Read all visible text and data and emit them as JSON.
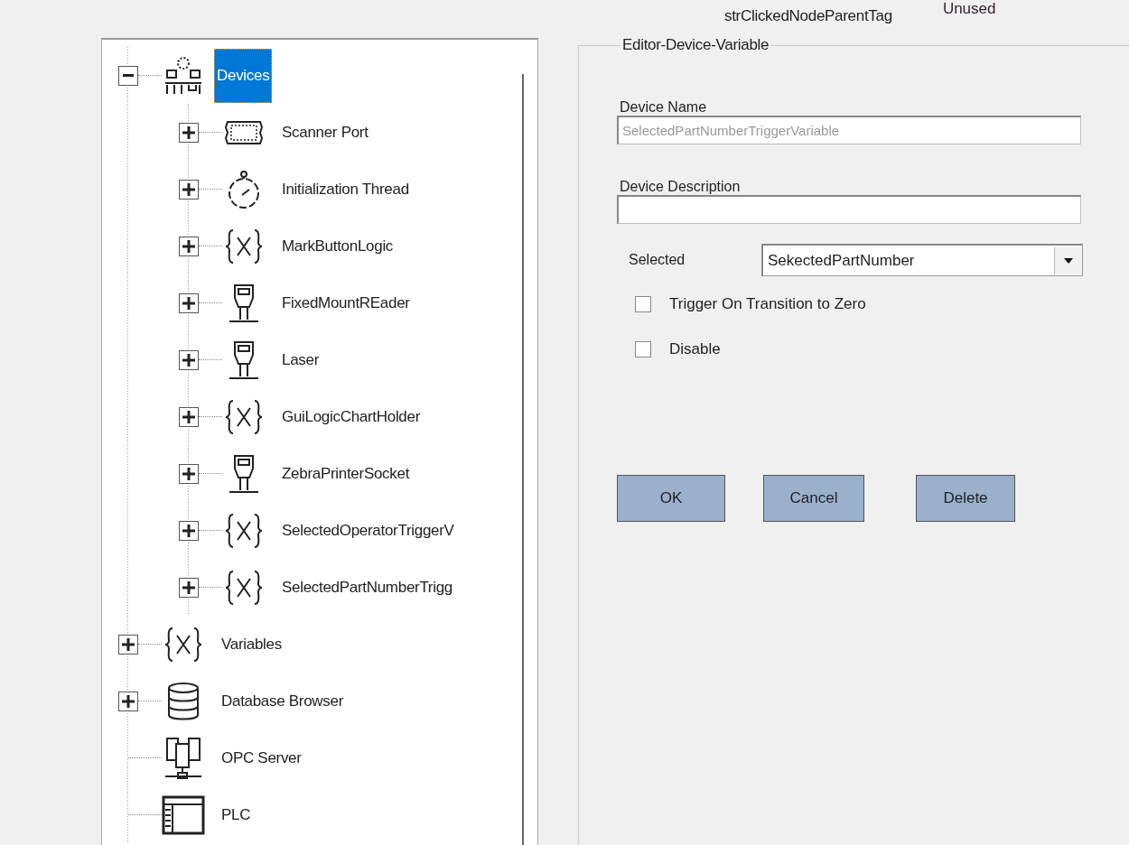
{
  "header": {
    "tag_label": "strClickedNodeParentTag",
    "tag_value": "Unused"
  },
  "tree": [
    {
      "label": "Devices",
      "kind": "network",
      "selected": true,
      "expanded": true,
      "children": [
        {
          "label": "Scanner Port",
          "kind": "port",
          "selected": false,
          "expanded": false
        },
        {
          "label": "Initialization Thread",
          "kind": "stopwatch",
          "selected": false,
          "expanded": false
        },
        {
          "label": "MarkButtonLogic",
          "kind": "variable",
          "selected": false,
          "expanded": false
        },
        {
          "label": "FixedMountREader",
          "kind": "scanner",
          "selected": false,
          "expanded": false
        },
        {
          "label": "Laser",
          "kind": "scanner",
          "selected": false,
          "expanded": false
        },
        {
          "label": "GuiLogicChartHolder",
          "kind": "variable",
          "selected": false,
          "expanded": false
        },
        {
          "label": "ZebraPrinterSocket",
          "kind": "scanner",
          "selected": false,
          "expanded": false
        },
        {
          "label": "SelectedOperatorTriggerV",
          "kind": "variable",
          "selected": false,
          "expanded": false
        },
        {
          "label": "SelectedPartNumberTrigg",
          "kind": "variable",
          "selected": false,
          "expanded": false
        }
      ]
    },
    {
      "label": "Variables",
      "kind": "variable",
      "selected": false,
      "expanded": false
    },
    {
      "label": "Database Browser",
      "kind": "database",
      "selected": false,
      "expanded": false
    },
    {
      "label": "OPC Server",
      "kind": "server",
      "selected": false
    },
    {
      "label": "PLC",
      "kind": "plc",
      "selected": false
    }
  ],
  "editor": {
    "title": "Editor-Device-Variable",
    "device_name": {
      "label": "Device Name",
      "value": "SelectedPartNumberTriggerVariable",
      "disabled": true
    },
    "device_description": {
      "label": "Device Description"
    },
    "selected": {
      "label": "Selected",
      "value": "SekectedPartNumber"
    },
    "checkboxes": [
      {
        "label": "Trigger On Transition to Zero",
        "checked": false
      },
      {
        "label": "Disable",
        "checked": false
      }
    ],
    "buttons": [
      "OK",
      "Cancel",
      "Delete"
    ]
  }
}
